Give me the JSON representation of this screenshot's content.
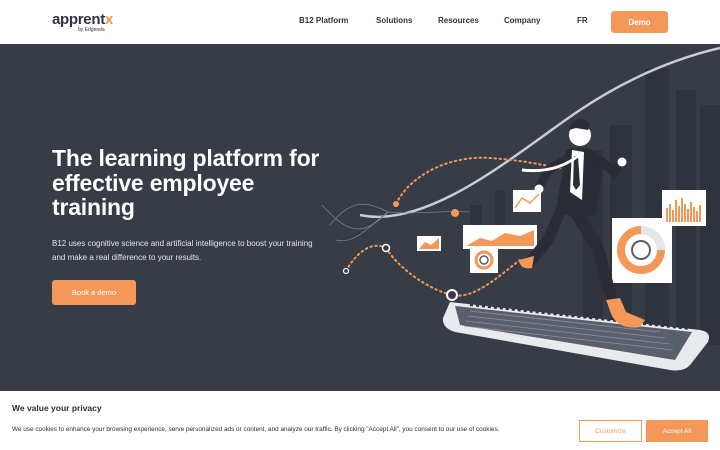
{
  "header": {
    "logo_main": "apprent",
    "logo_x": "x",
    "logo_sub": "by Edgenda",
    "nav": [
      "B12 Platform",
      "Solutions",
      "Resources",
      "Company",
      "FR"
    ],
    "demo_label": "Demo"
  },
  "hero": {
    "title": "The learning platform for effective employee training",
    "description": "B12 uses cognitive science and artificial intelligence to boost your training and make a real difference to your results.",
    "cta_label": "Book a demo"
  },
  "cookie": {
    "title": "We value your privacy",
    "text": "We use cookies to enhance your browsing experience, serve personalized ads or content, and analyze our traffic. By clicking \"Accept All\", you consent to our use of cookies.",
    "customize_label": "Customize",
    "accept_label": "Accept All"
  },
  "colors": {
    "accent": "#f4985a",
    "hero_bg": "#373c47",
    "header_bg": "#ffffff",
    "text_dark": "#2f3440"
  }
}
